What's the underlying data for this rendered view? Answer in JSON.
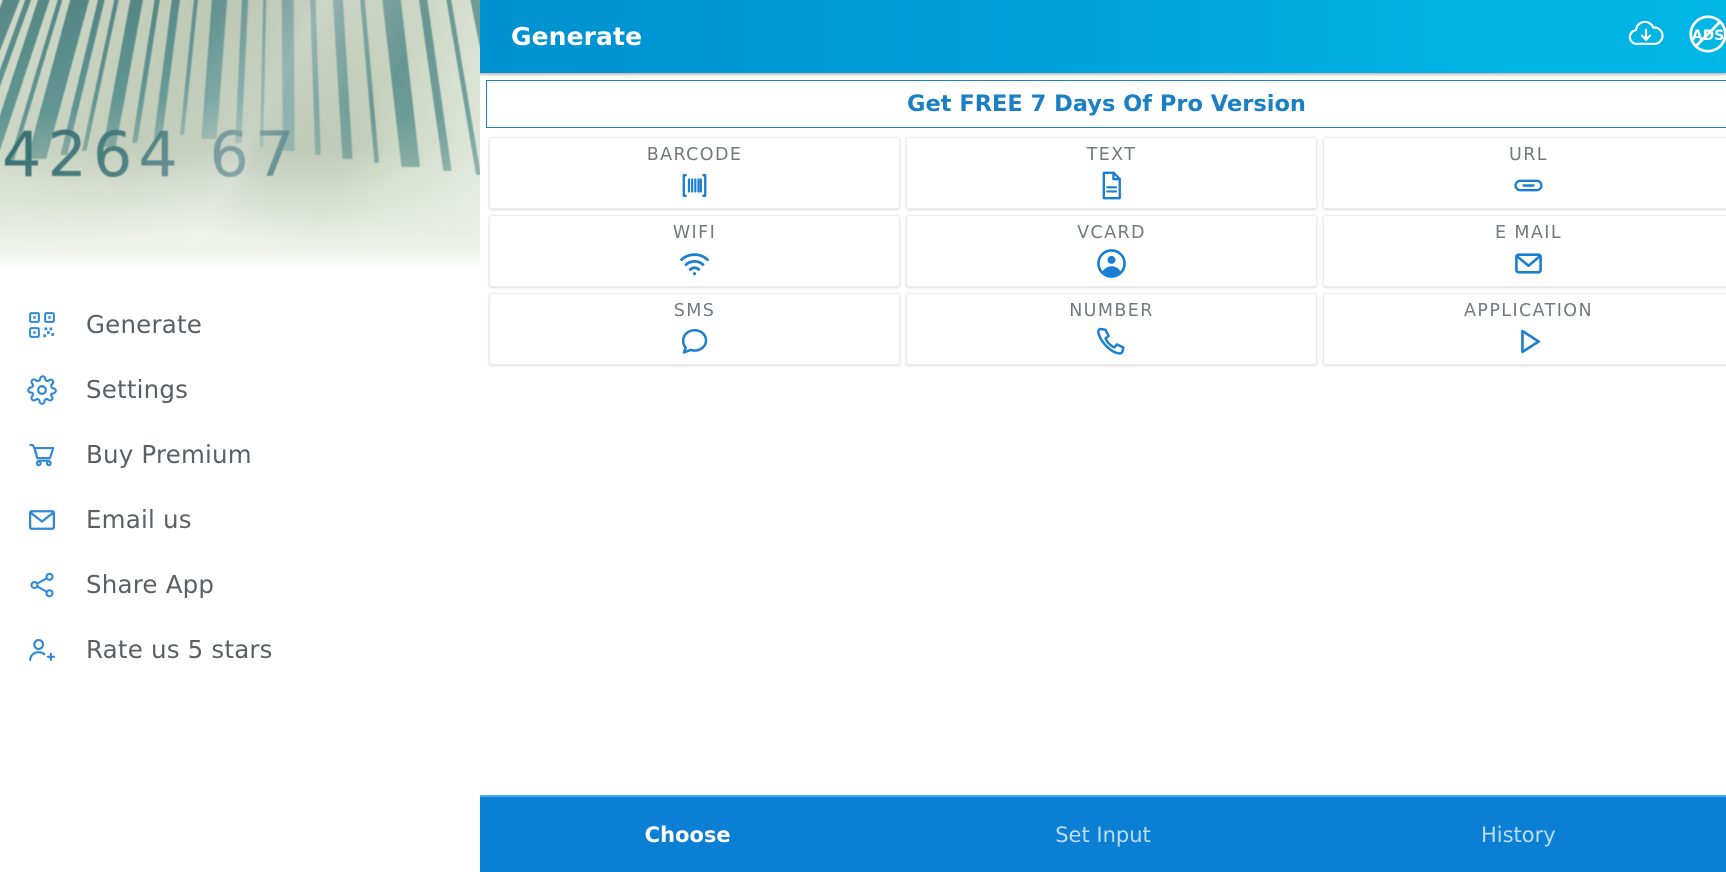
{
  "drawer": {
    "header_image": {
      "name": "barcode-photo",
      "digits_visible": "4264   67",
      "tint": "#1e5e62"
    },
    "items": [
      {
        "label": "Generate",
        "icon": "qr-code-icon",
        "name": "sidebar-item-generate"
      },
      {
        "label": "Settings",
        "icon": "gear-icon",
        "name": "sidebar-item-settings"
      },
      {
        "label": "Buy Premium",
        "icon": "cart-icon",
        "name": "sidebar-item-buy-premium"
      },
      {
        "label": "Email us",
        "icon": "envelope-icon",
        "name": "sidebar-item-email-us"
      },
      {
        "label": "Share App",
        "icon": "share-icon",
        "name": "sidebar-item-share-app"
      },
      {
        "label": "Rate us 5 stars",
        "icon": "person-add-icon",
        "name": "sidebar-item-rate-us"
      }
    ]
  },
  "appbar": {
    "title": "Generate",
    "actions": [
      {
        "label": "",
        "icon": "cloud-download-icon",
        "name": "download-button"
      },
      {
        "label": "",
        "icon": "no-ads-icon",
        "name": "remove-ads-button"
      }
    ],
    "bg_gradient_from": "#0091d0",
    "bg_gradient_to": "#00b6e6"
  },
  "promo": {
    "label": "Get FREE 7 Days Of Pro Version",
    "accent": "#1b7fc4"
  },
  "grid": {
    "rows": [
      [
        {
          "label": "BARCODE",
          "icon": "barcode-icon"
        },
        {
          "label": "TEXT",
          "icon": "document-icon"
        },
        {
          "label": "URL",
          "icon": "link-icon"
        }
      ],
      [
        {
          "label": "WIFI",
          "icon": "wifi-icon"
        },
        {
          "label": "VCARD",
          "icon": "account-circle-icon"
        },
        {
          "label": "E MAIL",
          "icon": "mail-icon"
        }
      ],
      [
        {
          "label": "SMS",
          "icon": "chat-bubble-icon"
        },
        {
          "label": "NUMBER",
          "icon": "phone-icon"
        },
        {
          "label": "APPLICATION",
          "icon": "play-triangle-icon"
        }
      ]
    ],
    "icon_color": "#1b7fd1",
    "label_color": "#75797e"
  },
  "bottom_nav": {
    "bg": "#0b7fd4",
    "items": [
      {
        "label": "Choose",
        "active": true
      },
      {
        "label": "Set Input",
        "active": false
      },
      {
        "label": "History",
        "active": false
      }
    ]
  }
}
